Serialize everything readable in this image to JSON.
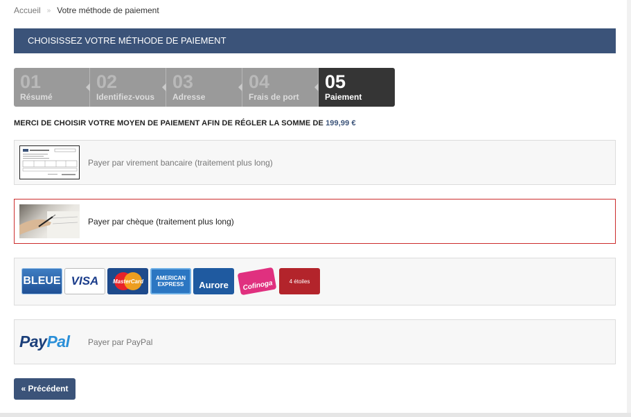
{
  "breadcrumb": {
    "home": "Accueil",
    "separator": "»",
    "current": "Votre méthode de paiement"
  },
  "title": "CHOISISSEZ VOTRE MÉTHODE DE PAIEMENT",
  "steps": [
    {
      "num": "01",
      "label": "Résumé"
    },
    {
      "num": "02",
      "label": "Identifiez-vous"
    },
    {
      "num": "03",
      "label": "Adresse"
    },
    {
      "num": "04",
      "label": "Frais de port"
    },
    {
      "num": "05",
      "label": "Paiement"
    }
  ],
  "instruction": {
    "text": "MERCI DE CHOISIR VOTRE MOYEN DE PAIEMENT AFIN DE RÉGLER LA SOMME DE ",
    "amount": "199,99 €"
  },
  "options": {
    "bank": "Payer par virement bancaire (traitement plus long)",
    "cheque": "Payer par chèque (traitement plus long)",
    "paypal": "Payer par PayPal"
  },
  "cards": [
    "BLEUE",
    "VISA",
    "MasterCard",
    "AMERICAN EXPRESS",
    "Aurore",
    "Cofinoga",
    "4 étoiles"
  ],
  "paypal_logo": {
    "pay": "Pay",
    "pal": "Pal"
  },
  "previous_button": "« Précédent",
  "colors": {
    "accent": "#3b5379",
    "selected_border": "#cc2b2b",
    "active_step": "#353535"
  }
}
